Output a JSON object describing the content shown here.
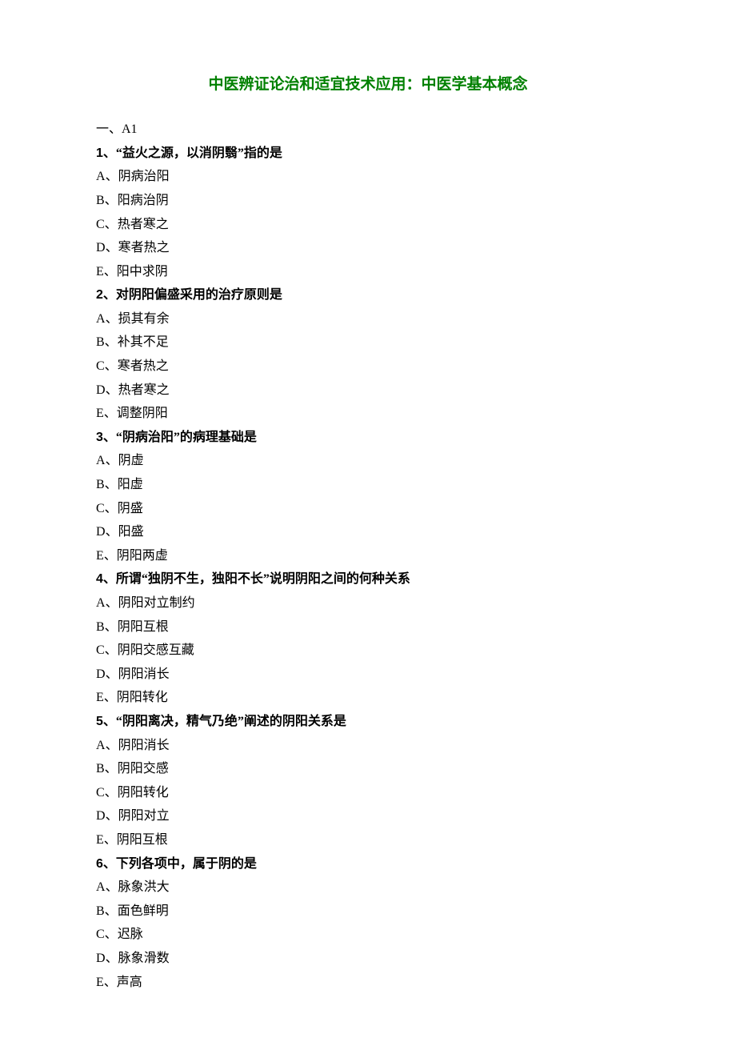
{
  "title": "中医辨证论治和适宜技术应用：中医学基本概念",
  "section": "一、A1",
  "questions": [
    {
      "num": "1",
      "stem": "“益火之源，以消阴翳”指的是",
      "options": [
        "阴病治阳",
        "阳病治阴",
        "热者寒之",
        "寒者热之",
        "阳中求阴"
      ]
    },
    {
      "num": "2",
      "stem": "对阴阳偏盛采用的治疗原则是",
      "options": [
        "损其有余",
        "补其不足",
        "寒者热之",
        "热者寒之",
        "调整阴阳"
      ]
    },
    {
      "num": "3",
      "stem": "“阴病治阳”的病理基础是",
      "options": [
        "阴虚",
        "阳虚",
        "阴盛",
        "阳盛",
        "阴阳两虚"
      ]
    },
    {
      "num": "4",
      "stem": "所谓“独阴不生，独阳不长”说明阴阳之间的何种关系",
      "options": [
        "阴阳对立制约",
        "阴阳互根",
        "阴阳交感互藏",
        "阴阳消长",
        "阴阳转化"
      ]
    },
    {
      "num": "5",
      "stem": "“阴阳离决，精气乃绝”阐述的阴阳关系是",
      "options": [
        "阴阳消长",
        "阴阳交感",
        "阴阳转化",
        "阴阳对立",
        "阴阳互根"
      ]
    },
    {
      "num": "6",
      "stem": "下列各项中，属于阴的是",
      "options": [
        "脉象洪大",
        "面色鲜明",
        "迟脉",
        "脉象滑数",
        "声高"
      ]
    }
  ],
  "optionLetters": [
    "A",
    "B",
    "C",
    "D",
    "E"
  ]
}
